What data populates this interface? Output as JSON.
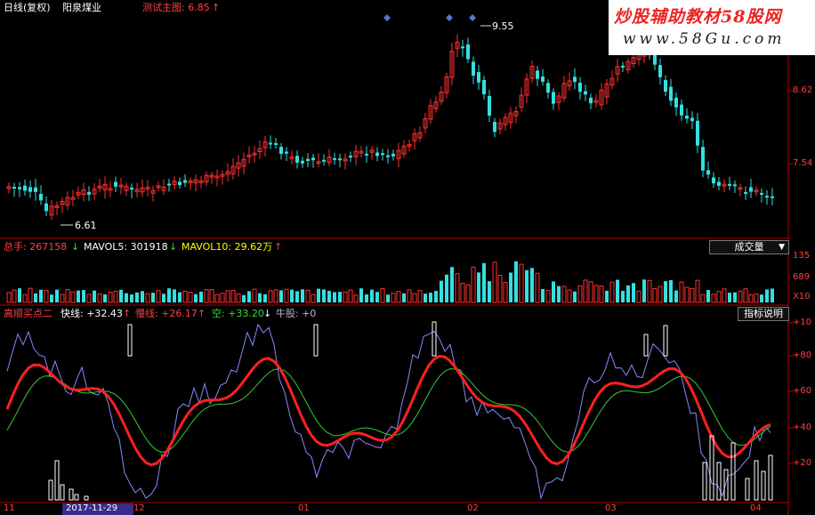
{
  "price_panel": {
    "title": "日线(复权)",
    "stock_name": "阳泉煤业",
    "indicator_label": "测试主图: 6.85",
    "indicator_arrow": "↑",
    "high_label": "9.55",
    "low_label": "6.61",
    "y_ticks": [
      "8.62",
      "7.54"
    ]
  },
  "volume_panel": {
    "label_total": "总手: 267158",
    "arrow_total": "↓",
    "label_mavol5": "MAVOL5: 301918",
    "arrow_mavol5": "↓",
    "label_mavol10": "MAVOL10: 29.62万",
    "arrow_mavol10": "↑",
    "dropdown_label": "成交量",
    "dropdown_icon": "triangle-down",
    "y_ticks": [
      "135",
      "689",
      "X10"
    ]
  },
  "indicator_panel": {
    "name": "高顺买点二",
    "fast_label": "快线: +32.43",
    "fast_arrow": "↑",
    "slow_label": "慢线: +26.17",
    "slow_arrow": "↑",
    "short_label": "空: +33.20",
    "short_arrow": "↓",
    "bull_label": "牛股: +0",
    "button_label": "指标说明",
    "y_ticks": [
      "+10",
      "+80",
      "+60",
      "+40",
      "+20"
    ]
  },
  "time_axis": {
    "labels": [
      "11",
      "2017-11-29",
      "12",
      "01",
      "02",
      "03",
      "04"
    ]
  },
  "watermark": {
    "line1": "炒股辅助教材58股网",
    "line2": "www.58Gu.com"
  },
  "colors": {
    "up": "#ff3030",
    "down": "#33e0e0",
    "fast": "#8888ff",
    "slow": "#ff2020",
    "signal": "#33cc33"
  }
}
